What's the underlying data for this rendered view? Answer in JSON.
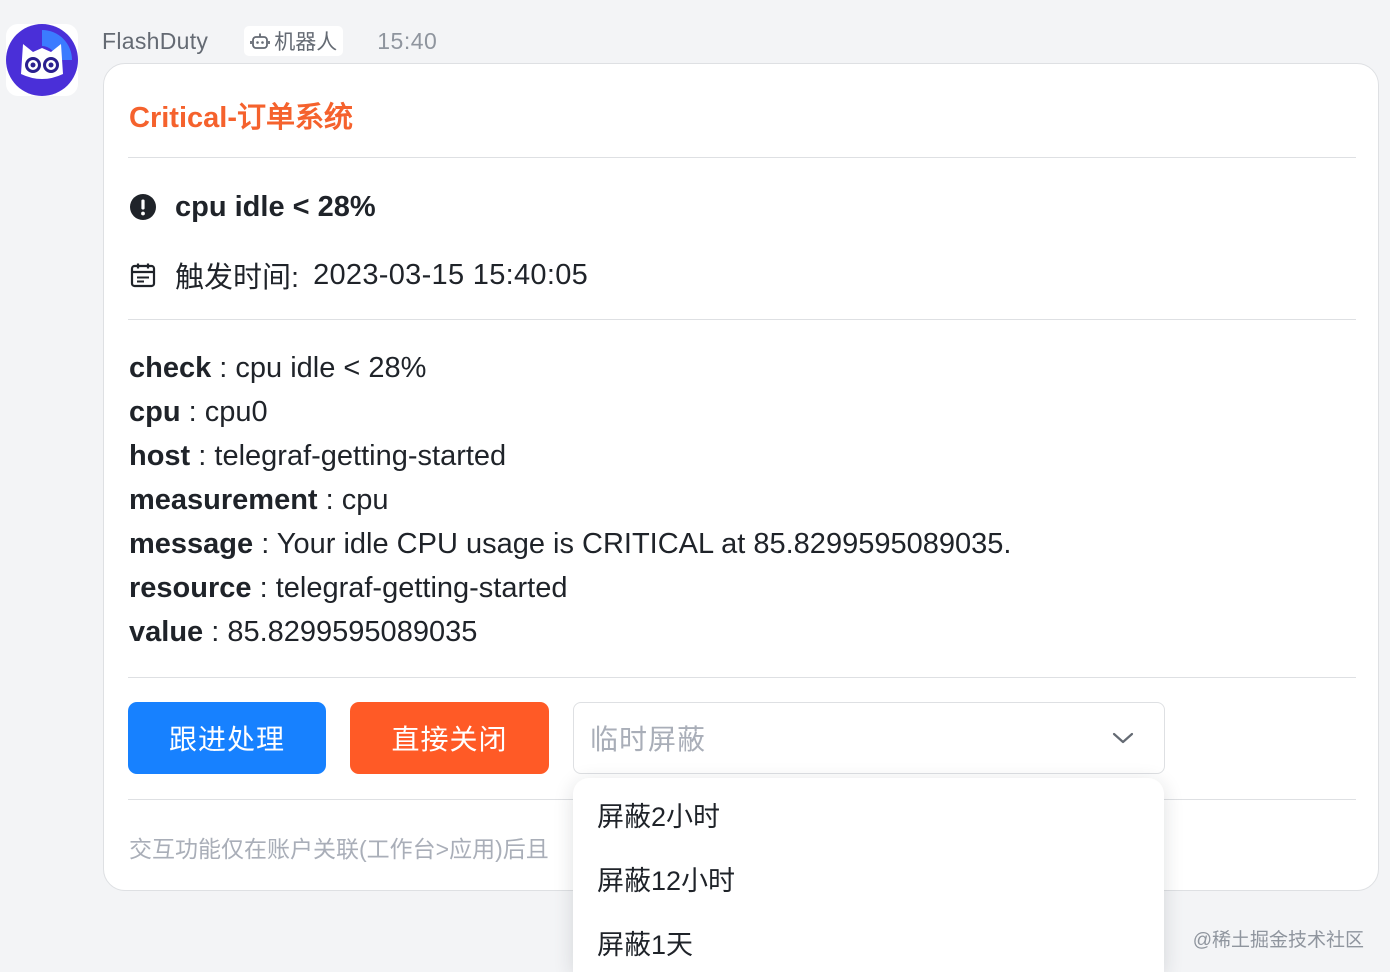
{
  "message": {
    "sender_name": "FlashDuty",
    "bot_tag_label": "机器人",
    "time": "15:40"
  },
  "card": {
    "title": "Critical-订单系统",
    "title_color": "#f5622d",
    "alert": {
      "icon": "exclamation-circle-icon",
      "text": "cpu idle < 28%"
    },
    "trigger": {
      "icon": "calendar-icon",
      "label": "触发时间:",
      "value": "2023-03-15 15:40:05"
    },
    "fields": [
      {
        "key": "check",
        "value": ": cpu idle < 28%"
      },
      {
        "key": "cpu",
        "value": ": cpu0"
      },
      {
        "key": "host",
        "value": ": telegraf-getting-started"
      },
      {
        "key": "measurement",
        "value": ": cpu"
      },
      {
        "key": "message",
        "value": ": Your idle CPU usage is CRITICAL at 85.8299595089035."
      },
      {
        "key": "resource",
        "value": ": telegraf-getting-started"
      },
      {
        "key": "value",
        "value": ": 85.8299595089035"
      }
    ],
    "actions": {
      "follow_up_label": "跟进处理",
      "follow_up_color": "#1781ff",
      "close_label": "直接关闭",
      "close_color": "#ff5a26",
      "mute_select_placeholder": "临时屏蔽"
    },
    "footer_note": "交互功能仅在账户关联(工作台>应用)后且"
  },
  "dropdown": {
    "options": [
      "屏蔽2小时",
      "屏蔽12小时",
      "屏蔽1天"
    ]
  },
  "watermark": "@稀土掘金技术社区"
}
